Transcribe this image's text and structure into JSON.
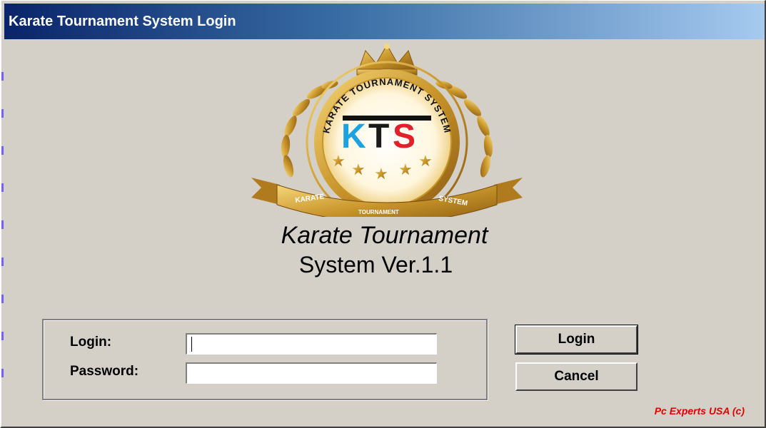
{
  "window": {
    "title": "Karate Tournament System Login"
  },
  "logo": {
    "icon": "kts-emblem-logo",
    "ring_text": "KARATE TOURNAMENT SYSTEM",
    "initials_k": "K",
    "initials_t": "T",
    "initials_s": "S",
    "ribbon_left": "KARATE",
    "ribbon_center": "TOURNAMENT",
    "ribbon_right": "SYSTEM",
    "colors": {
      "gold": "#c8952a",
      "blue": "#1aa3e0",
      "red": "#e0202a"
    }
  },
  "app_title": {
    "line1": "Karate Tournament",
    "line2": "System Ver.1.1"
  },
  "form": {
    "login_label": "Login:",
    "password_label": "Password:",
    "login_value": "",
    "password_value": ""
  },
  "buttons": {
    "login_label": "Login",
    "cancel_label": "Cancel"
  },
  "footer": {
    "copyright": "Pc Experts USA (c)"
  }
}
